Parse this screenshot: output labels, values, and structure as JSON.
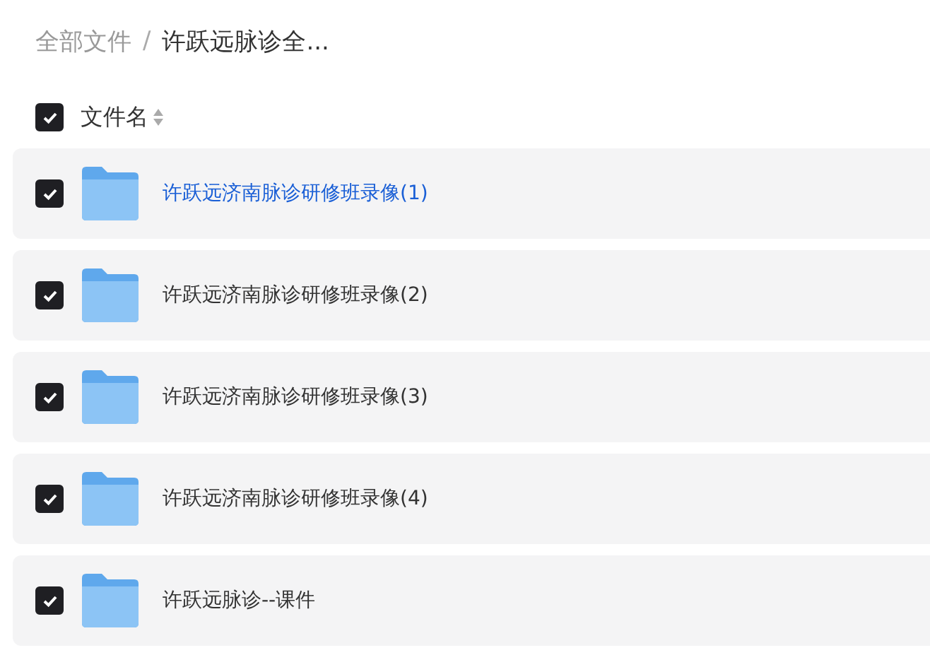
{
  "breadcrumb": [
    {
      "label": "全部文件",
      "current": false
    },
    {
      "label": "许跃远脉诊全...",
      "current": true
    }
  ],
  "breadcrumb_separator": "/",
  "header": {
    "label": "文件名",
    "checked": true
  },
  "files": [
    {
      "name": "许跃远济南脉诊研修班录像(1)",
      "checked": true,
      "hovered": true
    },
    {
      "name": "许跃远济南脉诊研修班录像(2)",
      "checked": true,
      "hovered": false
    },
    {
      "name": "许跃远济南脉诊研修班录像(3)",
      "checked": true,
      "hovered": false
    },
    {
      "name": "许跃远济南脉诊研修班录像(4)",
      "checked": true,
      "hovered": false
    },
    {
      "name": "许跃远脉诊--课件",
      "checked": true,
      "hovered": false
    }
  ]
}
